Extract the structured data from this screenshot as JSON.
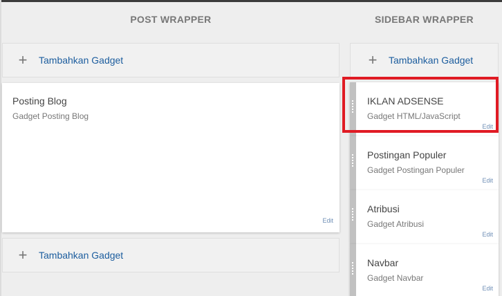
{
  "post": {
    "title": "POST WRAPPER",
    "add_top_label": "Tambahkan Gadget",
    "add_bottom_label": "Tambahkan Gadget",
    "gadget": {
      "title": "Posting Blog",
      "subtitle": "Gadget Posting Blog",
      "edit": "Edit"
    }
  },
  "sidebar": {
    "title": "SIDEBAR WRAPPER",
    "add_label": "Tambahkan Gadget",
    "gadgets": [
      {
        "title": "IKLAN ADSENSE",
        "subtitle": "Gadget HTML/JavaScript",
        "edit": "Edit"
      },
      {
        "title": "Postingan Populer",
        "subtitle": "Gadget Postingan Populer",
        "edit": "Edit"
      },
      {
        "title": "Atribusi",
        "subtitle": "Gadget Atribusi",
        "edit": "Edit"
      },
      {
        "title": "Navbar",
        "subtitle": "Gadget Navbar",
        "edit": "Edit"
      }
    ]
  },
  "icons": {
    "add": "plus-icon",
    "drag": "drag-handle-icon"
  },
  "colors": {
    "link": "#1c5d9e",
    "highlight": "#e01b24",
    "handle": "#c1c1c1"
  }
}
